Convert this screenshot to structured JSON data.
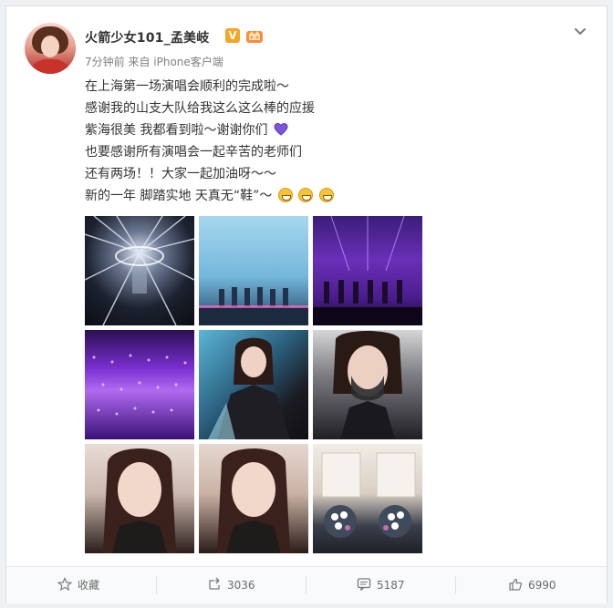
{
  "post": {
    "username": "火箭少女101_孟美岐",
    "verified_badge": "V",
    "meta": "7分钟前 来自 iPhone客户端",
    "lines": [
      "在上海第一场演唱会顺利的完成啦～",
      "感谢我的山支大队给我这么这么棒的应援",
      "紫海很美 我都看到啦～谢谢你们",
      "也要感谢所有演唱会一起辛苦的老师们",
      "还有两场！！大家一起加油呀～～",
      "新的一年 脚踏实地 天真无“鞋”～"
    ]
  },
  "images": [
    {
      "icon": "stage-lights-photo"
    },
    {
      "icon": "stage-performers-blue-photo"
    },
    {
      "icon": "stage-performers-purple-photo"
    },
    {
      "icon": "purple-lightstick-crowd-photo"
    },
    {
      "icon": "portrait-coat-photo"
    },
    {
      "icon": "portrait-mask-photo"
    },
    {
      "icon": "selfie-photo-1"
    },
    {
      "icon": "selfie-photo-2"
    },
    {
      "icon": "flower-bouquets-photo"
    }
  ],
  "actions": {
    "favorite_label": "收藏",
    "repost_count": "3036",
    "comment_count": "5187",
    "like_count": "6990"
  },
  "colors": {
    "accent_purple": "#7b57d8",
    "verified_orange": "#f5a623",
    "text_primary": "#333333",
    "text_meta": "#808080"
  }
}
